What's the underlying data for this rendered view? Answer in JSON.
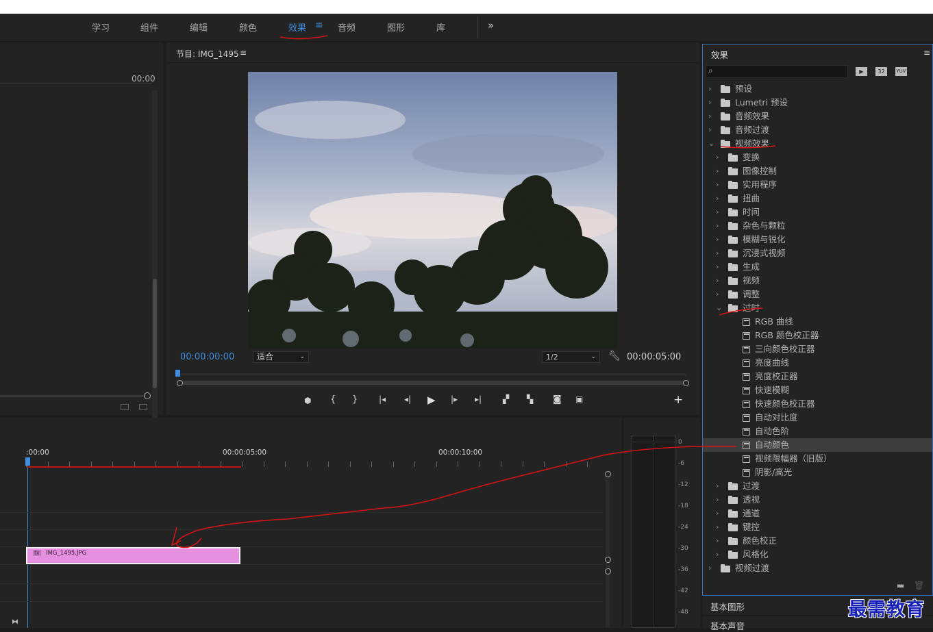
{
  "workspaces": {
    "tabs": [
      "学习",
      "组件",
      "编辑",
      "颜色",
      "效果",
      "音频",
      "图形",
      "库"
    ],
    "active": "效果",
    "menu_glyph": "≡",
    "overflow_glyph": "»"
  },
  "source": {
    "timecode": "00:00"
  },
  "program": {
    "title": "节目: IMG_1495",
    "menu_glyph": "≡",
    "timecode_current": "00:00:00:00",
    "timecode_total": "00:00:05:00",
    "fit_label": "适合",
    "resolution_label": "1/2",
    "add_glyph": "+"
  },
  "effects": {
    "title": "效果",
    "menu_glyph": "≡",
    "search_value": "",
    "filter_icons": [
      "accelerated-effects-icon",
      "32-bit-icon",
      "yuv-icon"
    ],
    "filter_labels": [
      "32",
      "YUV"
    ],
    "tree": [
      {
        "label": "预设",
        "level": 0,
        "kind": "preset-folder",
        "expanded": false
      },
      {
        "label": "Lumetri 预设",
        "level": 0,
        "kind": "preset-folder",
        "expanded": false
      },
      {
        "label": "音频效果",
        "level": 0,
        "kind": "folder",
        "expanded": false
      },
      {
        "label": "音频过渡",
        "level": 0,
        "kind": "folder",
        "expanded": false
      },
      {
        "label": "视频效果",
        "level": 0,
        "kind": "folder",
        "expanded": true
      },
      {
        "label": "变换",
        "level": 1,
        "kind": "folder",
        "expanded": false
      },
      {
        "label": "图像控制",
        "level": 1,
        "kind": "folder",
        "expanded": false
      },
      {
        "label": "实用程序",
        "level": 1,
        "kind": "folder",
        "expanded": false
      },
      {
        "label": "扭曲",
        "level": 1,
        "kind": "folder",
        "expanded": false
      },
      {
        "label": "时间",
        "level": 1,
        "kind": "folder",
        "expanded": false
      },
      {
        "label": "杂色与颗粒",
        "level": 1,
        "kind": "folder",
        "expanded": false
      },
      {
        "label": "模糊与锐化",
        "level": 1,
        "kind": "folder",
        "expanded": false
      },
      {
        "label": "沉浸式视频",
        "level": 1,
        "kind": "folder",
        "expanded": false
      },
      {
        "label": "生成",
        "level": 1,
        "kind": "folder",
        "expanded": false
      },
      {
        "label": "视频",
        "level": 1,
        "kind": "folder",
        "expanded": false
      },
      {
        "label": "调整",
        "level": 1,
        "kind": "folder",
        "expanded": false
      },
      {
        "label": "过时",
        "level": 1,
        "kind": "folder",
        "expanded": true
      },
      {
        "label": "RGB 曲线",
        "level": 2,
        "kind": "effect"
      },
      {
        "label": "RGB 颜色校正器",
        "level": 2,
        "kind": "effect"
      },
      {
        "label": "三向颜色校正器",
        "level": 2,
        "kind": "effect"
      },
      {
        "label": "亮度曲线",
        "level": 2,
        "kind": "effect"
      },
      {
        "label": "亮度校正器",
        "level": 2,
        "kind": "effect"
      },
      {
        "label": "快速模糊",
        "level": 2,
        "kind": "effect"
      },
      {
        "label": "快速颜色校正器",
        "level": 2,
        "kind": "effect"
      },
      {
        "label": "自动对比度",
        "level": 2,
        "kind": "effect"
      },
      {
        "label": "自动色阶",
        "level": 2,
        "kind": "effect"
      },
      {
        "label": "自动颜色",
        "level": 2,
        "kind": "effect",
        "selected": true
      },
      {
        "label": "视频限幅器（旧版）",
        "level": 2,
        "kind": "effect"
      },
      {
        "label": "阴影/高光",
        "level": 2,
        "kind": "effect"
      },
      {
        "label": "过渡",
        "level": 1,
        "kind": "folder",
        "expanded": false
      },
      {
        "label": "透视",
        "level": 1,
        "kind": "folder",
        "expanded": false
      },
      {
        "label": "通道",
        "level": 1,
        "kind": "folder",
        "expanded": false
      },
      {
        "label": "键控",
        "level": 1,
        "kind": "folder",
        "expanded": false
      },
      {
        "label": "颜色校正",
        "level": 1,
        "kind": "folder",
        "expanded": false
      },
      {
        "label": "风格化",
        "level": 1,
        "kind": "folder",
        "expanded": false
      },
      {
        "label": "视频过渡",
        "level": 0,
        "kind": "folder",
        "expanded": false
      }
    ]
  },
  "panels_below": [
    "基本图形",
    "基本声音"
  ],
  "timeline": {
    "ruler_labels": [
      ":00:00",
      "00:00:05:00",
      "00:00:10:00"
    ],
    "clip_name": "IMG_1495.JPG",
    "clip_fx": "fx"
  },
  "meter": {
    "scale": [
      "0",
      "-6",
      "-12",
      "-18",
      "-24",
      "-30",
      "-36",
      "-42",
      "-48"
    ]
  },
  "watermark": "最需教育",
  "colors": {
    "accent": "#3d8fe0",
    "clip": "#e58fe0",
    "annotation": "#d41414",
    "panel_border": "#3473c5"
  }
}
